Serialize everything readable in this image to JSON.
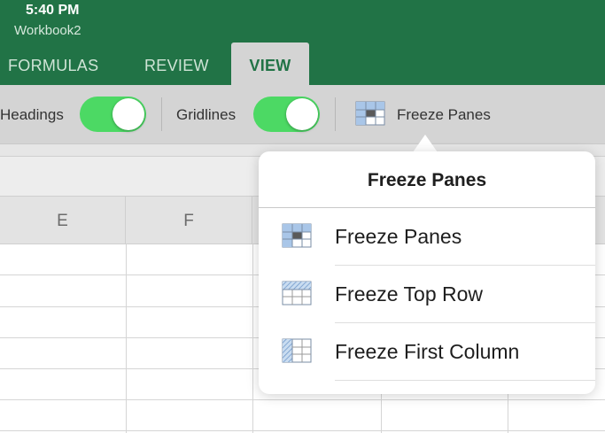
{
  "status": {
    "time": "5:40 PM"
  },
  "document": {
    "title": "Workbook2"
  },
  "tabs": [
    {
      "label": "FORMULAS"
    },
    {
      "label": "REVIEW"
    },
    {
      "label": "VIEW"
    }
  ],
  "active_tab": "VIEW",
  "ribbon": {
    "headings_label": "Headings",
    "headings_on": true,
    "gridlines_label": "Gridlines",
    "gridlines_on": true,
    "freeze_panes_label": "Freeze Panes"
  },
  "grid": {
    "columns": [
      "E",
      "F"
    ]
  },
  "popover": {
    "title": "Freeze Panes",
    "items": [
      {
        "label": "Freeze Panes",
        "icon": "freeze-panes-icon"
      },
      {
        "label": "Freeze Top Row",
        "icon": "freeze-top-row-icon"
      },
      {
        "label": "Freeze First Column",
        "icon": "freeze-first-column-icon"
      }
    ]
  },
  "colors": {
    "header_green": "#217346",
    "toggle_on": "#4cd964",
    "ribbon_bg": "#d4d4d4",
    "icon_blue": "#a9c6e8"
  }
}
